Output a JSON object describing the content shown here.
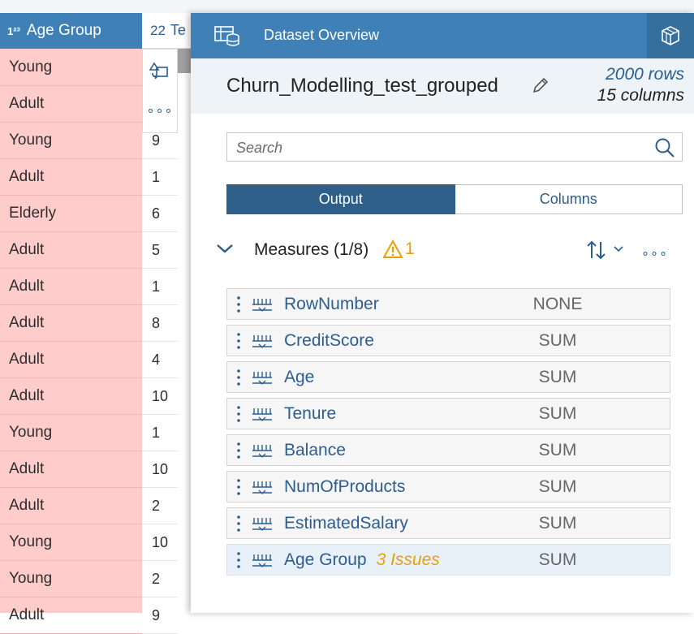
{
  "grid": {
    "age_header": {
      "type_badge": "1²³",
      "label": "Age Group"
    },
    "tenure_header": {
      "type_badge": "22",
      "label": "Te"
    },
    "age_values": [
      "Young",
      "Adult",
      "Young",
      "Adult",
      "Elderly",
      "Adult",
      "Adult",
      "Adult",
      "Adult",
      "Adult",
      "Young",
      "Adult",
      "Adult",
      "Young",
      "Young",
      "Adult"
    ],
    "tenure_values": [
      "9",
      "1",
      "6",
      "5",
      "1",
      "8",
      "4",
      "10",
      "1",
      "10",
      "2",
      "10",
      "2",
      "9"
    ],
    "tool_more": "∘∘∘"
  },
  "panel": {
    "title": "Dataset Overview",
    "dataset_name": "Churn_Modelling_test_grouped",
    "rows_text": "2000 rows",
    "columns_text": "15 columns",
    "search_placeholder": "Search",
    "tabs": [
      {
        "label": "Output",
        "active": true
      },
      {
        "label": "Columns",
        "active": false
      }
    ],
    "measures_label": "Measures (1/8)",
    "warning_count": "1",
    "more_label": "∘∘∘",
    "measures": [
      {
        "name": "RowNumber",
        "agg": "NONE",
        "issues": ""
      },
      {
        "name": "CreditScore",
        "agg": "SUM",
        "issues": ""
      },
      {
        "name": "Age",
        "agg": "SUM",
        "issues": ""
      },
      {
        "name": "Tenure",
        "agg": "SUM",
        "issues": ""
      },
      {
        "name": "Balance",
        "agg": "SUM",
        "issues": ""
      },
      {
        "name": "NumOfProducts",
        "agg": "SUM",
        "issues": ""
      },
      {
        "name": "EstimatedSalary",
        "agg": "SUM",
        "issues": ""
      },
      {
        "name": "Age Group",
        "agg": "SUM",
        "issues": "3 Issues"
      }
    ]
  },
  "colors": {
    "header_blue": "#3f81b7",
    "active_tab": "#2e5f8a",
    "link_blue": "#2c5d8f",
    "warning": "#e8a100",
    "age_column_bg": "#ffcccc"
  },
  "icons": [
    "table-stack-icon",
    "cube-icon",
    "edit-pencil-icon",
    "search-icon",
    "chevron-down-icon",
    "warning-icon",
    "sort-icon",
    "more-icon",
    "drag-grip-icon",
    "measure-ruler-icon"
  ]
}
